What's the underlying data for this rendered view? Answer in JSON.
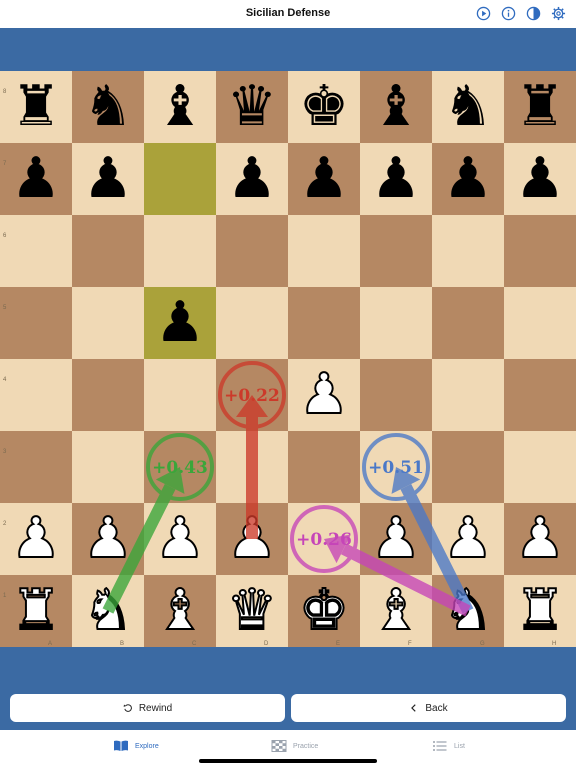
{
  "header": {
    "title": "Sicilian Defense"
  },
  "board": {
    "ranks": [
      "8",
      "7",
      "6",
      "5",
      "4",
      "3",
      "2",
      "1"
    ],
    "files": [
      "A",
      "B",
      "C",
      "D",
      "E",
      "F",
      "G",
      "H"
    ],
    "highlight_squares": [
      "c7",
      "c5"
    ],
    "black_pieces": [
      {
        "sq": "a8",
        "glyph": "♜"
      },
      {
        "sq": "b8",
        "glyph": "♞"
      },
      {
        "sq": "c8",
        "glyph": "♝"
      },
      {
        "sq": "d8",
        "glyph": "♛"
      },
      {
        "sq": "e8",
        "glyph": "♚"
      },
      {
        "sq": "f8",
        "glyph": "♝"
      },
      {
        "sq": "g8",
        "glyph": "♞"
      },
      {
        "sq": "h8",
        "glyph": "♜"
      },
      {
        "sq": "a7",
        "glyph": "♟"
      },
      {
        "sq": "b7",
        "glyph": "♟"
      },
      {
        "sq": "d7",
        "glyph": "♟"
      },
      {
        "sq": "e7",
        "glyph": "♟"
      },
      {
        "sq": "f7",
        "glyph": "♟"
      },
      {
        "sq": "g7",
        "glyph": "♟"
      },
      {
        "sq": "h7",
        "glyph": "♟"
      },
      {
        "sq": "c5",
        "glyph": "♟"
      }
    ],
    "white_pieces": [
      {
        "sq": "e4",
        "glyph": "♟"
      },
      {
        "sq": "a2",
        "glyph": "♟"
      },
      {
        "sq": "b2",
        "glyph": "♟"
      },
      {
        "sq": "c2",
        "glyph": "♟"
      },
      {
        "sq": "d2",
        "glyph": "♟"
      },
      {
        "sq": "f2",
        "glyph": "♟"
      },
      {
        "sq": "g2",
        "glyph": "♟"
      },
      {
        "sq": "h2",
        "glyph": "♟"
      },
      {
        "sq": "a1",
        "glyph": "♜"
      },
      {
        "sq": "b1",
        "glyph": "♞"
      },
      {
        "sq": "c1",
        "glyph": "♝"
      },
      {
        "sq": "d1",
        "glyph": "♛"
      },
      {
        "sq": "e1",
        "glyph": "♚"
      },
      {
        "sq": "f1",
        "glyph": "♝"
      },
      {
        "sq": "g1",
        "glyph": "♞"
      },
      {
        "sq": "h1",
        "glyph": "♜"
      }
    ],
    "moves": [
      {
        "from": "b1",
        "to": "c3",
        "score": "+0.43",
        "color": "#3aa63a"
      },
      {
        "from": "d2",
        "to": "d4",
        "score": "+0.22",
        "color": "#cc3a2a"
      },
      {
        "from": "g1",
        "to": "f3",
        "score": "+0.51",
        "color": "#4a78c8"
      },
      {
        "from": "g1",
        "to": "e2",
        "score": "+0.26",
        "color": "#c645b8"
      }
    ]
  },
  "actions": {
    "rewind_label": "Rewind",
    "back_label": "Back"
  },
  "tabs": {
    "explore": "Explore",
    "practice": "Practice",
    "list": "List"
  },
  "colors": {
    "accent": "#2f6bbf",
    "band": "#3b6aa3",
    "light_square": "#f0d9b5",
    "dark_square": "#b58863",
    "highlight": "#aaa23a"
  }
}
